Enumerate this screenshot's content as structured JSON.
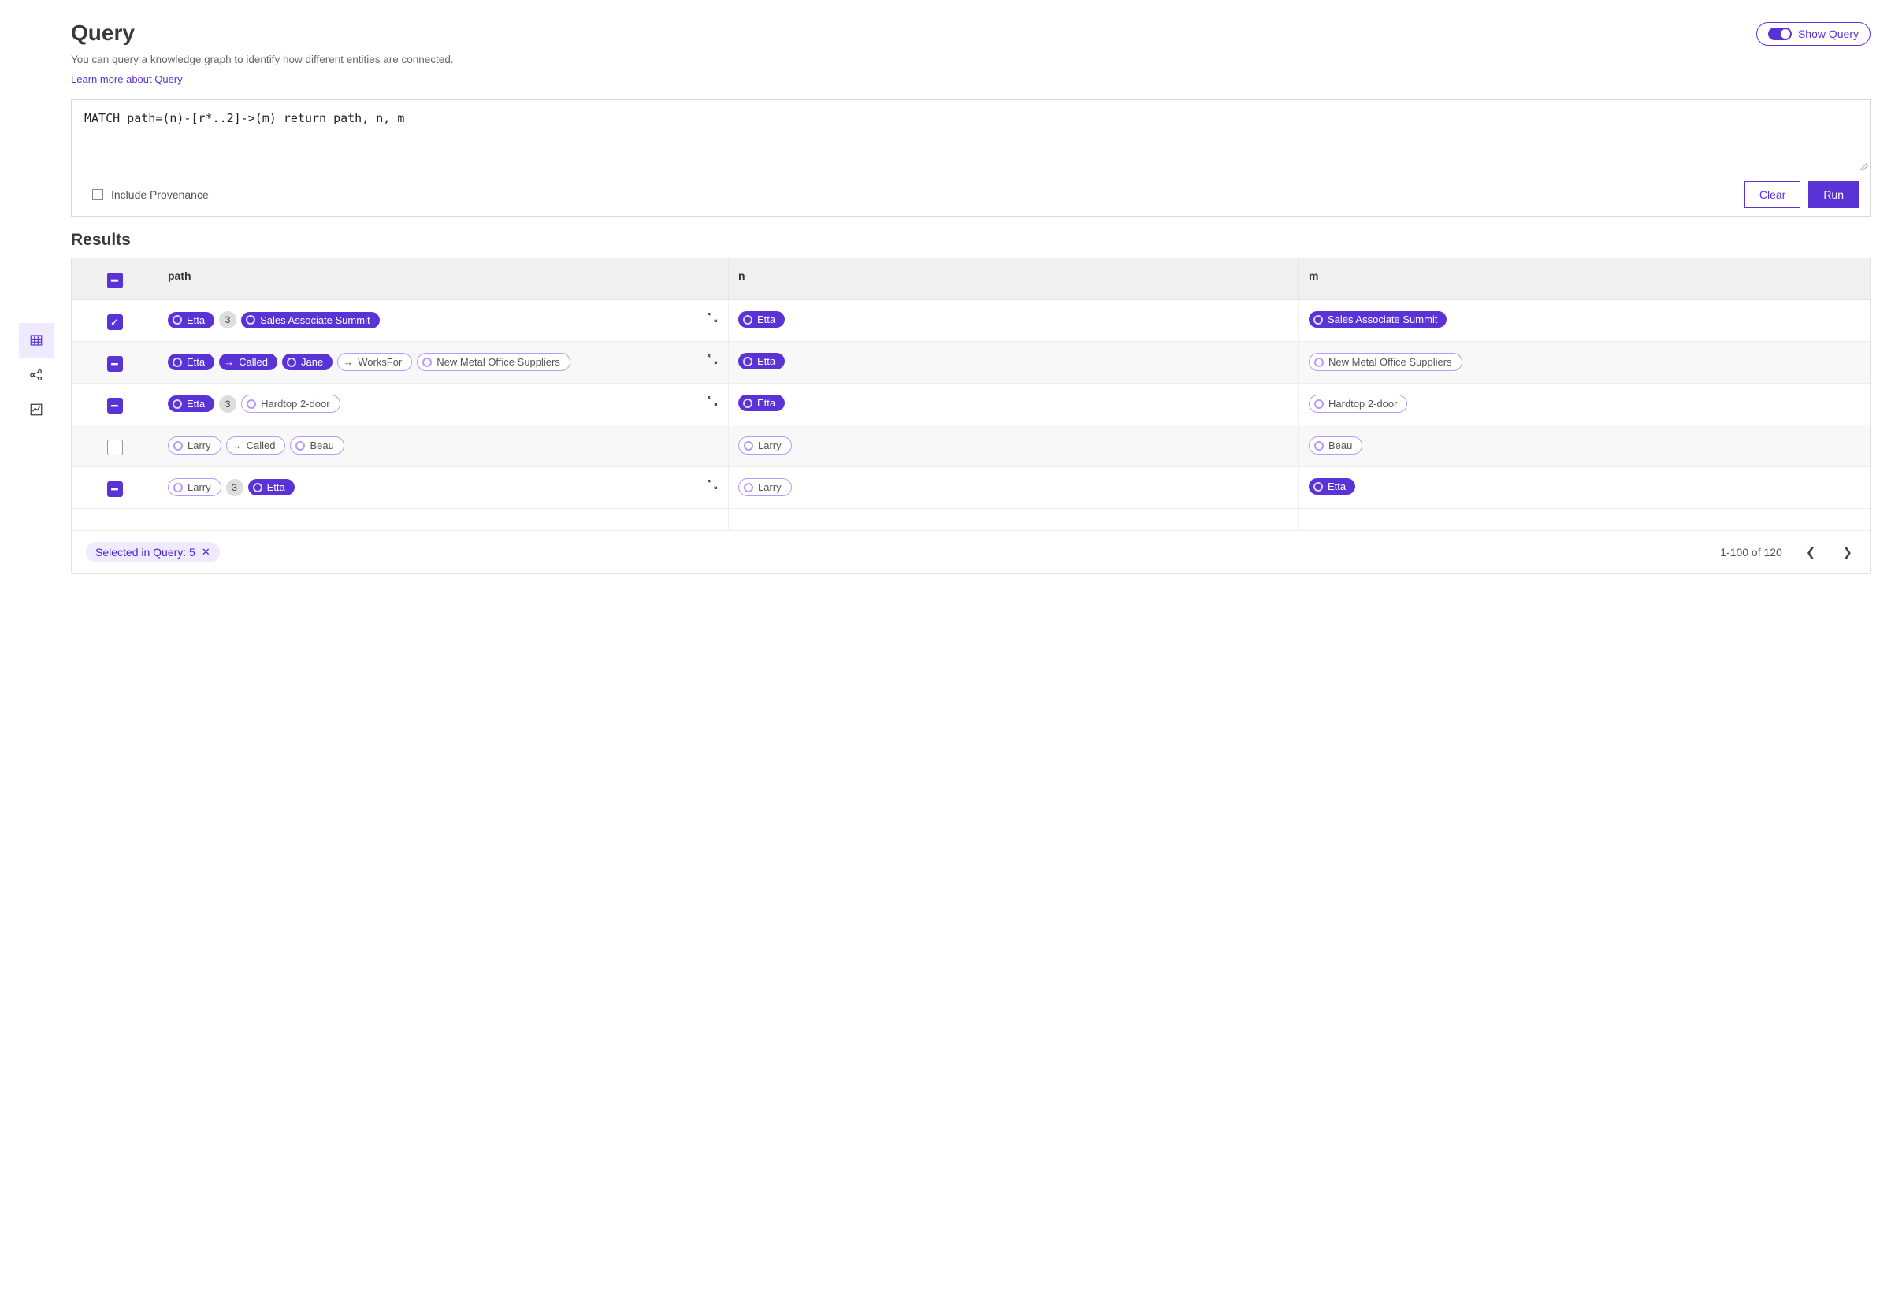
{
  "header": {
    "title": "Query",
    "subtitle": "You can query a knowledge graph to identify how different entities are connected.",
    "learn_more": "Learn more about Query",
    "show_query_label": "Show Query"
  },
  "query": {
    "text": "MATCH path=(n)-[r*..2]->(m) return path, n, m",
    "include_prov": "Include Provenance",
    "clear": "Clear",
    "run": "Run"
  },
  "results": {
    "title": "Results",
    "cols": {
      "path": "path",
      "n": "n",
      "m": "m"
    },
    "rows": [
      {
        "state": "checked",
        "expand": true,
        "path": [
          {
            "t": "node",
            "label": "Etta",
            "style": "filled"
          },
          {
            "t": "count",
            "label": "3"
          },
          {
            "t": "node",
            "label": "Sales Associate Summit",
            "style": "filled"
          }
        ],
        "n": [
          {
            "t": "node",
            "label": "Etta",
            "style": "filled"
          }
        ],
        "m": [
          {
            "t": "node",
            "label": "Sales Associate Summit",
            "style": "filled"
          }
        ]
      },
      {
        "state": "indet",
        "expand": true,
        "path": [
          {
            "t": "node",
            "label": "Etta",
            "style": "filled"
          },
          {
            "t": "edge",
            "label": "Called",
            "style": "filled"
          },
          {
            "t": "node",
            "label": "Jane",
            "style": "filled"
          },
          {
            "t": "edge",
            "label": "WorksFor",
            "style": "outl"
          },
          {
            "t": "node",
            "label": "New Metal Office Suppliers",
            "style": "outl"
          }
        ],
        "n": [
          {
            "t": "node",
            "label": "Etta",
            "style": "filled"
          }
        ],
        "m": [
          {
            "t": "node",
            "label": "New Metal Office Suppliers",
            "style": "outl"
          }
        ]
      },
      {
        "state": "indet",
        "expand": true,
        "path": [
          {
            "t": "node",
            "label": "Etta",
            "style": "filled"
          },
          {
            "t": "count",
            "label": "3"
          },
          {
            "t": "node",
            "label": "Hardtop 2-door",
            "style": "outl"
          }
        ],
        "n": [
          {
            "t": "node",
            "label": "Etta",
            "style": "filled"
          }
        ],
        "m": [
          {
            "t": "node",
            "label": "Hardtop 2-door",
            "style": "outl"
          }
        ]
      },
      {
        "state": "unchecked",
        "expand": false,
        "path": [
          {
            "t": "node",
            "label": "Larry",
            "style": "outl"
          },
          {
            "t": "edge",
            "label": "Called",
            "style": "outl"
          },
          {
            "t": "node",
            "label": "Beau",
            "style": "outl"
          }
        ],
        "n": [
          {
            "t": "node",
            "label": "Larry",
            "style": "outl"
          }
        ],
        "m": [
          {
            "t": "node",
            "label": "Beau",
            "style": "outl"
          }
        ]
      },
      {
        "state": "indet",
        "expand": true,
        "path": [
          {
            "t": "node",
            "label": "Larry",
            "style": "outl"
          },
          {
            "t": "count",
            "label": "3"
          },
          {
            "t": "node",
            "label": "Etta",
            "style": "filled"
          }
        ],
        "n": [
          {
            "t": "node",
            "label": "Larry",
            "style": "outl"
          }
        ],
        "m": [
          {
            "t": "node",
            "label": "Etta",
            "style": "filled"
          }
        ]
      }
    ],
    "header_state": "indet"
  },
  "footer": {
    "selected_label": "Selected in Query: 5",
    "range": "1-100 of 120"
  }
}
